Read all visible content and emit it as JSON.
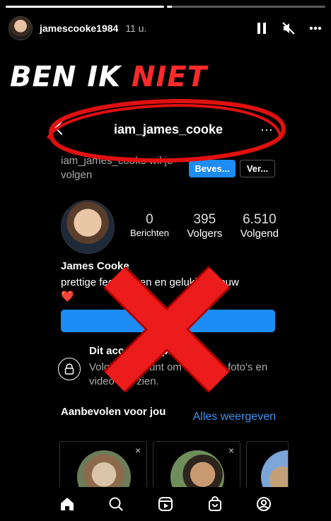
{
  "story": {
    "username": "jamescooke1984",
    "time": "11 u.",
    "progress": [
      1.0,
      0.03
    ]
  },
  "headline": {
    "part1": "BEN IK",
    "part2": "NIET"
  },
  "profile": {
    "username": "iam_james_cooke",
    "more_label": "···",
    "request_text": "iam_james_cooke wil je volgen",
    "confirm_label": "Beves...",
    "more_button_label": "Ver...",
    "stats": [
      {
        "value": "0",
        "label": "Berichten"
      },
      {
        "value": "395",
        "label": "Volgers"
      },
      {
        "value": "6.510",
        "label": "Volgend"
      }
    ],
    "full_name": "James Cooke",
    "bio": "prettige feestdagen en gelukkig nieuw",
    "bio_heart": "❤️",
    "private_title": "Dit account is privé",
    "private_text": "Volg dit account om zijn/haar foto's en video's te zien.",
    "suggested_title": "Aanbevolen voor jou",
    "see_all": "Alles weergeven",
    "card_close": "×"
  },
  "colors": {
    "accent_red": "#ff2a2a",
    "instagram_blue": "#1e8cf5",
    "link_blue": "#3d95f3"
  },
  "icons": [
    "pause-icon",
    "mute-icon",
    "more-icon",
    "home-icon",
    "search-icon",
    "reels-icon",
    "shop-icon",
    "profile-icon"
  ]
}
